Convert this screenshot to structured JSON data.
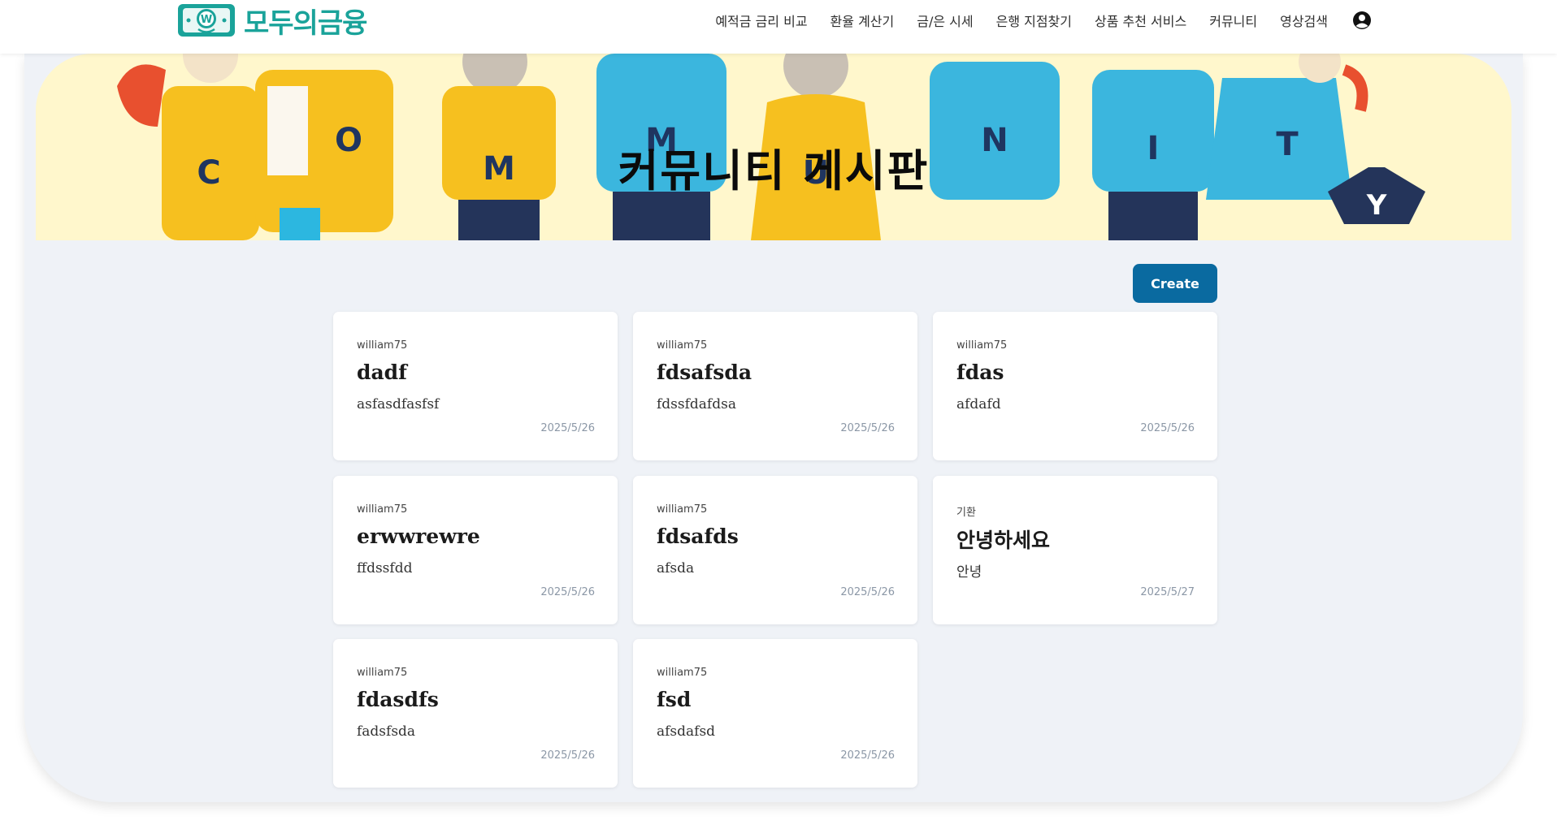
{
  "header": {
    "logo_text": "모두의금융",
    "logo_colors": {
      "primary": "#1aa39a",
      "accent": "#f6c431"
    },
    "nav": [
      {
        "label": "예적금 금리 비교"
      },
      {
        "label": "환율 계산기"
      },
      {
        "label": "금/은 시세"
      },
      {
        "label": "은행 지점찾기"
      },
      {
        "label": "상품 추천 서비스"
      },
      {
        "label": "커뮤니티"
      },
      {
        "label": "영상검색"
      }
    ],
    "user_icon": "user-circle-icon"
  },
  "banner": {
    "title": "커뮤니티 게시판",
    "image_letters": [
      "C",
      "O",
      "M",
      "M",
      "U",
      "N",
      "I",
      "T",
      "Y"
    ]
  },
  "actions": {
    "create_label": "Create",
    "create_color": "#0a6aa0"
  },
  "posts": [
    {
      "author": "william75",
      "title": "dadf",
      "body": "asfasdfasfsf",
      "date": "2025/5/26"
    },
    {
      "author": "william75",
      "title": "fdsafsda",
      "body": "fdssfdafdsa",
      "date": "2025/5/26"
    },
    {
      "author": "william75",
      "title": "fdas",
      "body": "afdafd",
      "date": "2025/5/26"
    },
    {
      "author": "william75",
      "title": "erwwrewre",
      "body": "ffdssfdd",
      "date": "2025/5/26"
    },
    {
      "author": "william75",
      "title": "fdsafds",
      "body": "afsda",
      "date": "2025/5/26"
    },
    {
      "author": "기환",
      "title": "안녕하세요",
      "body": "안녕",
      "date": "2025/5/27"
    },
    {
      "author": "william75",
      "title": "fdasdfs",
      "body": "fadsfsda",
      "date": "2025/5/26"
    },
    {
      "author": "william75",
      "title": "fsd",
      "body": "afsdafsd",
      "date": "2025/5/26"
    }
  ]
}
